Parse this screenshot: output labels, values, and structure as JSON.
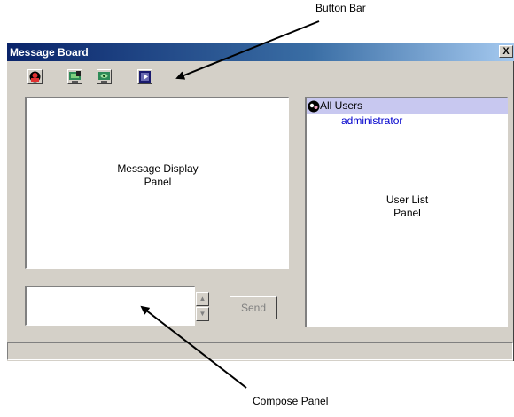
{
  "annotations": {
    "button_bar": "Button Bar",
    "compose_panel": "Compose Panel"
  },
  "window": {
    "title": "Message Board",
    "close_label": "X"
  },
  "toolbar": {
    "buttons": [
      {
        "icon": "user-status-icon"
      },
      {
        "icon": "lock-screen-icon"
      },
      {
        "icon": "monitor-view-icon"
      },
      {
        "icon": "media-play-icon"
      }
    ]
  },
  "message_display": {
    "label_line1": "Message Display",
    "label_line2": "Panel"
  },
  "compose": {
    "value": "",
    "send_label": "Send"
  },
  "user_list": {
    "all_users": "All Users",
    "users": [
      "administrator"
    ],
    "label_line1": "User List",
    "label_line2": "Panel"
  },
  "colors": {
    "title_bar": "#0a246a",
    "selected_row": "#c8c8f0",
    "user_link": "#0000cc"
  }
}
